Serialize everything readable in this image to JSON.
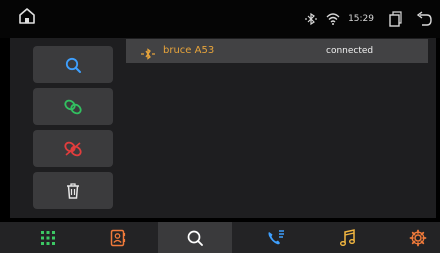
{
  "status": {
    "time": "15:29"
  },
  "device": {
    "name": "bruce A53",
    "state": "connected"
  },
  "side_buttons": [
    {
      "icon": "search-icon",
      "color": "#3ea0ff"
    },
    {
      "icon": "link-icon",
      "color": "#32c060"
    },
    {
      "icon": "unlink-icon",
      "color": "#e13d3d"
    },
    {
      "icon": "trash-icon",
      "color": "#e6e6e6"
    }
  ],
  "bottom_tabs": [
    {
      "icon": "dialpad-icon",
      "color": "#3cc864"
    },
    {
      "icon": "contacts-icon",
      "color": "#f07a3a"
    },
    {
      "icon": "search-icon",
      "color": "#ffffff",
      "active": true
    },
    {
      "icon": "call-log-icon",
      "color": "#3ea0ff"
    },
    {
      "icon": "music-icon",
      "color": "#f2b640"
    },
    {
      "icon": "settings-icon",
      "color": "#f07a3a"
    }
  ]
}
